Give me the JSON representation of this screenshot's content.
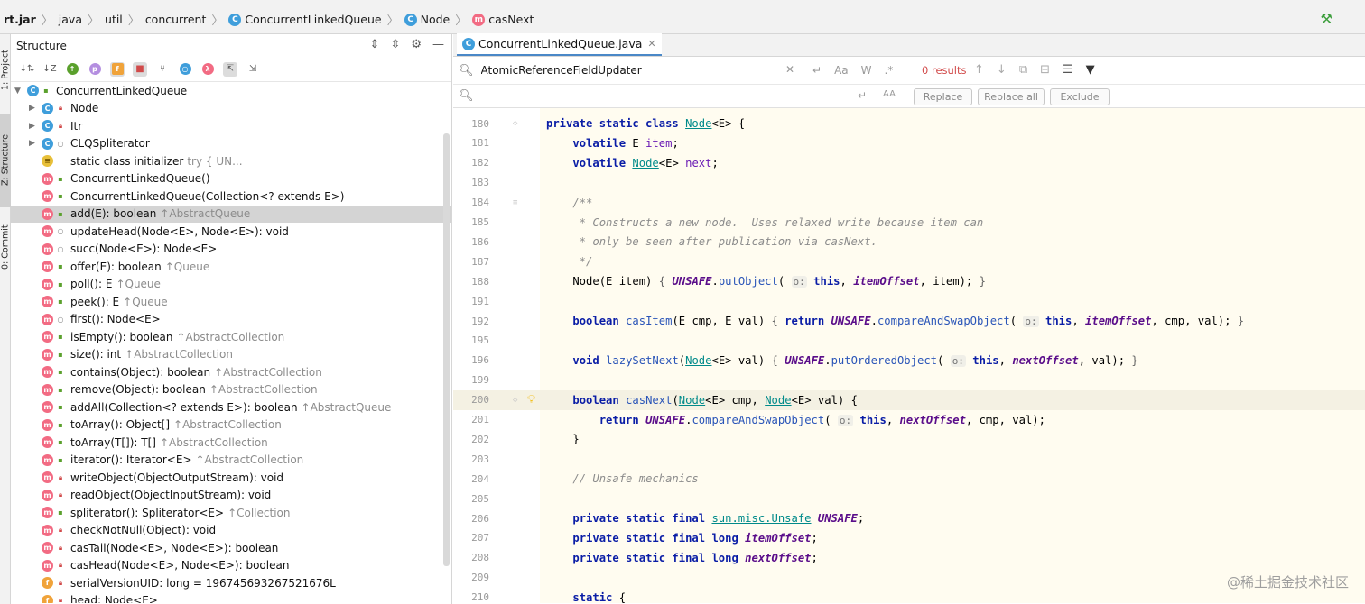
{
  "breadcrumb": [
    {
      "label": "rt.jar",
      "icon": ""
    },
    {
      "label": "java",
      "icon": ""
    },
    {
      "label": "util",
      "icon": ""
    },
    {
      "label": "concurrent",
      "icon": ""
    },
    {
      "label": "ConcurrentLinkedQueue",
      "icon": "class-icon"
    },
    {
      "label": "Node",
      "icon": "class-icon"
    },
    {
      "label": "casNext",
      "icon": "method-icon"
    }
  ],
  "left_strip": {
    "project": "1: Project",
    "structure": "Z: Structure",
    "commit": "0: Commit"
  },
  "structure_panel": {
    "title": "Structure",
    "tree": [
      {
        "depth": 0,
        "arrow": "▼",
        "icon": "C",
        "kind": "c",
        "vis": "pub",
        "name": "ConcurrentLinkedQueue",
        "hint": ""
      },
      {
        "depth": 1,
        "arrow": "▶",
        "icon": "C",
        "kind": "c",
        "vis": "pri",
        "name": "Node",
        "hint": ""
      },
      {
        "depth": 1,
        "arrow": "▶",
        "icon": "C",
        "kind": "c",
        "vis": "pri",
        "name": "Itr",
        "hint": ""
      },
      {
        "depth": 1,
        "arrow": "▶",
        "icon": "C",
        "kind": "c",
        "vis": "pkg",
        "name": "CLQSpliterator",
        "hint": ""
      },
      {
        "depth": 1,
        "arrow": "",
        "icon": "≡",
        "kind": "s",
        "vis": "",
        "name": "static class initializer",
        "hint": "try {          UN..."
      },
      {
        "depth": 1,
        "arrow": "",
        "icon": "m",
        "kind": "m",
        "vis": "pub",
        "name": "ConcurrentLinkedQueue()",
        "hint": ""
      },
      {
        "depth": 1,
        "arrow": "",
        "icon": "m",
        "kind": "m",
        "vis": "pub",
        "name": "ConcurrentLinkedQueue(Collection<? extends E>)",
        "hint": ""
      },
      {
        "depth": 1,
        "arrow": "",
        "icon": "m",
        "kind": "m",
        "vis": "pub",
        "name": "add(E): boolean",
        "hint": "↑AbstractQueue",
        "selected": true
      },
      {
        "depth": 1,
        "arrow": "",
        "icon": "m",
        "kind": "m",
        "vis": "pkg",
        "name": "updateHead(Node<E>, Node<E>): void",
        "hint": ""
      },
      {
        "depth": 1,
        "arrow": "",
        "icon": "m",
        "kind": "m",
        "vis": "pkg",
        "name": "succ(Node<E>): Node<E>",
        "hint": ""
      },
      {
        "depth": 1,
        "arrow": "",
        "icon": "m",
        "kind": "m",
        "vis": "pub",
        "name": "offer(E): boolean",
        "hint": "↑Queue"
      },
      {
        "depth": 1,
        "arrow": "",
        "icon": "m",
        "kind": "m",
        "vis": "pub",
        "name": "poll(): E",
        "hint": "↑Queue"
      },
      {
        "depth": 1,
        "arrow": "",
        "icon": "m",
        "kind": "m",
        "vis": "pub",
        "name": "peek(): E",
        "hint": "↑Queue"
      },
      {
        "depth": 1,
        "arrow": "",
        "icon": "m",
        "kind": "m",
        "vis": "pkg",
        "name": "first(): Node<E>",
        "hint": ""
      },
      {
        "depth": 1,
        "arrow": "",
        "icon": "m",
        "kind": "m",
        "vis": "pub",
        "name": "isEmpty(): boolean",
        "hint": "↑AbstractCollection"
      },
      {
        "depth": 1,
        "arrow": "",
        "icon": "m",
        "kind": "m",
        "vis": "pub",
        "name": "size(): int",
        "hint": "↑AbstractCollection"
      },
      {
        "depth": 1,
        "arrow": "",
        "icon": "m",
        "kind": "m",
        "vis": "pub",
        "name": "contains(Object): boolean",
        "hint": "↑AbstractCollection"
      },
      {
        "depth": 1,
        "arrow": "",
        "icon": "m",
        "kind": "m",
        "vis": "pub",
        "name": "remove(Object): boolean",
        "hint": "↑AbstractCollection"
      },
      {
        "depth": 1,
        "arrow": "",
        "icon": "m",
        "kind": "m",
        "vis": "pub",
        "name": "addAll(Collection<? extends E>): boolean",
        "hint": "↑AbstractQueue"
      },
      {
        "depth": 1,
        "arrow": "",
        "icon": "m",
        "kind": "m",
        "vis": "pub",
        "name": "toArray(): Object[]",
        "hint": "↑AbstractCollection"
      },
      {
        "depth": 1,
        "arrow": "",
        "icon": "m",
        "kind": "m",
        "vis": "pub",
        "name": "toArray(T[]): T[]",
        "hint": "↑AbstractCollection"
      },
      {
        "depth": 1,
        "arrow": "",
        "icon": "m",
        "kind": "m",
        "vis": "pub",
        "name": "iterator(): Iterator<E>",
        "hint": "↑AbstractCollection"
      },
      {
        "depth": 1,
        "arrow": "",
        "icon": "m",
        "kind": "m",
        "vis": "pri",
        "name": "writeObject(ObjectOutputStream): void",
        "hint": ""
      },
      {
        "depth": 1,
        "arrow": "",
        "icon": "m",
        "kind": "m",
        "vis": "pri",
        "name": "readObject(ObjectInputStream): void",
        "hint": ""
      },
      {
        "depth": 1,
        "arrow": "",
        "icon": "m",
        "kind": "m",
        "vis": "pub",
        "name": "spliterator(): Spliterator<E>",
        "hint": "↑Collection"
      },
      {
        "depth": 1,
        "arrow": "",
        "icon": "m",
        "kind": "m",
        "vis": "pri",
        "name": "checkNotNull(Object): void",
        "hint": ""
      },
      {
        "depth": 1,
        "arrow": "",
        "icon": "m",
        "kind": "m",
        "vis": "pri",
        "name": "casTail(Node<E>, Node<E>): boolean",
        "hint": ""
      },
      {
        "depth": 1,
        "arrow": "",
        "icon": "m",
        "kind": "m",
        "vis": "pri",
        "name": "casHead(Node<E>, Node<E>): boolean",
        "hint": ""
      },
      {
        "depth": 1,
        "arrow": "",
        "icon": "f",
        "kind": "f",
        "vis": "pri",
        "name": "serialVersionUID: long = 196745693267521676L",
        "hint": ""
      },
      {
        "depth": 1,
        "arrow": "",
        "icon": "f",
        "kind": "f",
        "vis": "pri",
        "name": "head: Node<E>",
        "hint": ""
      }
    ]
  },
  "editor": {
    "tab_label": "ConcurrentLinkedQueue.java",
    "find": {
      "value": "AtomicReferenceFieldUpdater",
      "results": "0 results"
    },
    "replace": {
      "value": "",
      "buttons": [
        "Replace",
        "Replace all",
        "Exclude"
      ]
    },
    "lines": [
      {
        "n": "180",
        "html": "<span class=\"kw\">private static class</span> <span class=\"cls\">Node</span>&lt;E&gt; {"
      },
      {
        "n": "181",
        "html": "    <span class=\"kw\">volatile</span> E <span class=\"fld\">item</span>;"
      },
      {
        "n": "182",
        "html": "    <span class=\"kw\">volatile</span> <span class=\"cls\">Node</span>&lt;E&gt; <span class=\"fld\">next</span>;"
      },
      {
        "n": "183",
        "html": ""
      },
      {
        "n": "184",
        "html": "    <span class=\"cm\">/**</span>"
      },
      {
        "n": "185",
        "html": "<span class=\"cm\">     * Constructs a new node.  Uses relaxed write because item can</span>"
      },
      {
        "n": "186",
        "html": "<span class=\"cm\">     * only be seen after publication via casNext.</span>"
      },
      {
        "n": "187",
        "html": "<span class=\"cm\">     */</span>"
      },
      {
        "n": "188",
        "html": "    Node(E item) <span class=\"fold\">{</span> <span class=\"sfld\">UNSAFE</span>.<span class=\"fn\">putObject</span>( <span class=\"hint\">o:</span> <span class=\"kw\">this</span>, <span class=\"sfld\">itemOffset</span>, item); <span class=\"fold\">}</span>"
      },
      {
        "n": "191",
        "html": ""
      },
      {
        "n": "192",
        "html": "    <span class=\"kw\">boolean</span> <span class=\"fn\">casItem</span>(E cmp, E val) <span class=\"fold\">{</span> <span class=\"kw\">return</span> <span class=\"sfld\">UNSAFE</span>.<span class=\"fn\">compareAndSwapObject</span>( <span class=\"hint\">o:</span> <span class=\"kw\">this</span>, <span class=\"sfld\">itemOffset</span>, cmp, val); <span class=\"fold\">}</span>"
      },
      {
        "n": "195",
        "html": ""
      },
      {
        "n": "196",
        "html": "    <span class=\"kw\">void</span> <span class=\"fn\">lazySetNext</span>(<span class=\"cls\">Node</span>&lt;E&gt; val) <span class=\"fold\">{</span> <span class=\"sfld\">UNSAFE</span>.<span class=\"fn\">putOrderedObject</span>( <span class=\"hint\">o:</span> <span class=\"kw\">this</span>, <span class=\"sfld\">nextOffset</span>, val); <span class=\"fold\">}</span>"
      },
      {
        "n": "199",
        "html": ""
      },
      {
        "n": "200",
        "html": "    <span class=\"kw\">boolean</span> <span class=\"fn\">casNext</span>(<span class=\"cls\">Node</span>&lt;E&gt; cmp, <span class=\"cls\">Node</span>&lt;E&gt; val) {",
        "hl": true
      },
      {
        "n": "201",
        "html": "        <span class=\"kw\">return</span> <span class=\"sfld\">UNSAFE</span>.<span class=\"fn\">compareAndSwapObject</span>( <span class=\"hint\">o:</span> <span class=\"kw\">this</span>, <span class=\"sfld\">nextOffset</span>, cmp, val);"
      },
      {
        "n": "202",
        "html": "    }"
      },
      {
        "n": "203",
        "html": ""
      },
      {
        "n": "204",
        "html": "    <span class=\"cm\">// Unsafe mechanics</span>"
      },
      {
        "n": "205",
        "html": ""
      },
      {
        "n": "206",
        "html": "    <span class=\"kw\">private static final</span> <span class=\"cls\">sun.misc.Unsafe</span> <span class=\"sfld\">UNSAFE</span>;"
      },
      {
        "n": "207",
        "html": "    <span class=\"kw\">private static final long</span> <span class=\"sfld\">itemOffset</span>;"
      },
      {
        "n": "208",
        "html": "    <span class=\"kw\">private static final long</span> <span class=\"sfld\">nextOffset</span>;"
      },
      {
        "n": "209",
        "html": ""
      },
      {
        "n": "210",
        "html": "    <span class=\"kw\">static</span> {"
      }
    ]
  },
  "watermark": "@稀土掘金技术社区"
}
